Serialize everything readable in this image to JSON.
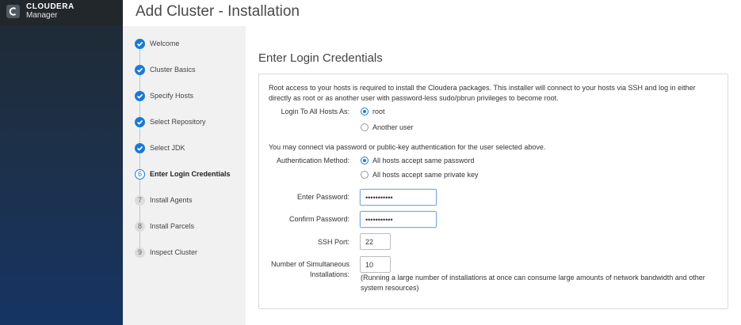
{
  "brand": {
    "name": "CLOUDERA",
    "sub": "Manager"
  },
  "header": {
    "title": "Add Cluster - Installation"
  },
  "steps": [
    {
      "label": "Welcome",
      "state": "done",
      "number": ""
    },
    {
      "label": "Cluster Basics",
      "state": "done",
      "number": ""
    },
    {
      "label": "Specify Hosts",
      "state": "done",
      "number": ""
    },
    {
      "label": "Select Repository",
      "state": "done",
      "number": ""
    },
    {
      "label": "Select JDK",
      "state": "done",
      "number": ""
    },
    {
      "label": "Enter Login Credentials",
      "state": "current",
      "number": "6"
    },
    {
      "label": "Install Agents",
      "state": "todo",
      "number": "7"
    },
    {
      "label": "Install Parcels",
      "state": "todo",
      "number": "8"
    },
    {
      "label": "Inspect Cluster",
      "state": "todo",
      "number": "9"
    }
  ],
  "main": {
    "section_title": "Enter Login Credentials",
    "intro_line1": "Root access to your hosts is required to install the Cloudera packages. This installer will connect to your hosts via SSH and log in either",
    "intro_line2": "directly as root or as another user with password-less sudo/pbrun privileges to become root.",
    "login_label": "Login To All Hosts As:",
    "login_options": [
      "root",
      "Another user"
    ],
    "auth_note": "You may connect via password or public-key authentication for the user selected above.",
    "auth_label": "Authentication Method:",
    "auth_options": [
      "All hosts accept same password",
      "All hosts accept same private key"
    ],
    "password_label": "Enter Password:",
    "password_value": "•••••••••••",
    "confirm_label": "Confirm Password:",
    "confirm_value": "•••••••••••",
    "ssh_label": "SSH Port:",
    "ssh_value": "22",
    "simul_label_1": "Number of Simultaneous",
    "simul_label_2": "Installations:",
    "simul_value": "10",
    "simul_note_1": "(Running a large number of installations at once can consume large amounts of network bandwidth and other",
    "simul_note_2": "system resources)"
  }
}
